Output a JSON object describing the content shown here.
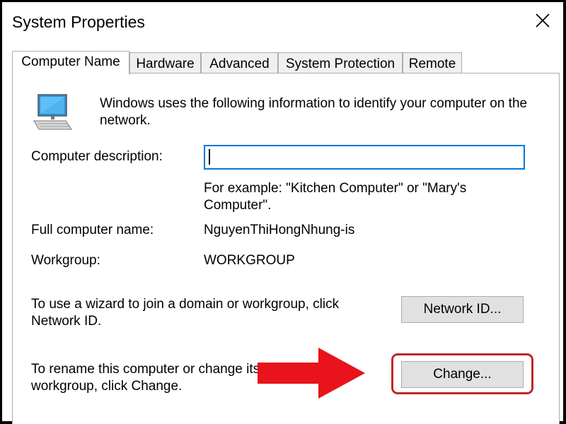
{
  "window": {
    "title": "System Properties"
  },
  "tabs": [
    {
      "label": "Computer Name",
      "active": true
    },
    {
      "label": "Hardware",
      "active": false
    },
    {
      "label": "Advanced",
      "active": false
    },
    {
      "label": "System Protection",
      "active": false
    },
    {
      "label": "Remote",
      "active": false
    }
  ],
  "computer_name": {
    "intro_text": "Windows uses the following information to identify your computer on the network.",
    "description_label": "Computer description:",
    "description_value": "",
    "description_example": "For example: \"Kitchen Computer\" or \"Mary's Computer\".",
    "full_name_label": "Full computer name:",
    "full_name_value": "NguyenThiHongNhung-is",
    "workgroup_label": "Workgroup:",
    "workgroup_value": "WORKGROUP",
    "network_id_text": "To use a wizard to join a domain or workgroup, click Network ID.",
    "network_id_button": "Network ID...",
    "rename_text": "To rename this computer or change its domain or workgroup, click Change.",
    "change_button": "Change..."
  },
  "annotation": {
    "arrow_color": "#e8131b",
    "highlight_color": "#c0262d"
  },
  "icons": {
    "close": "close-icon",
    "computer": "computer-icon"
  },
  "colors": {
    "focus_border": "#0078d7",
    "button_bg": "#e1e1e1",
    "tab_bg": "#f0f0f0"
  }
}
